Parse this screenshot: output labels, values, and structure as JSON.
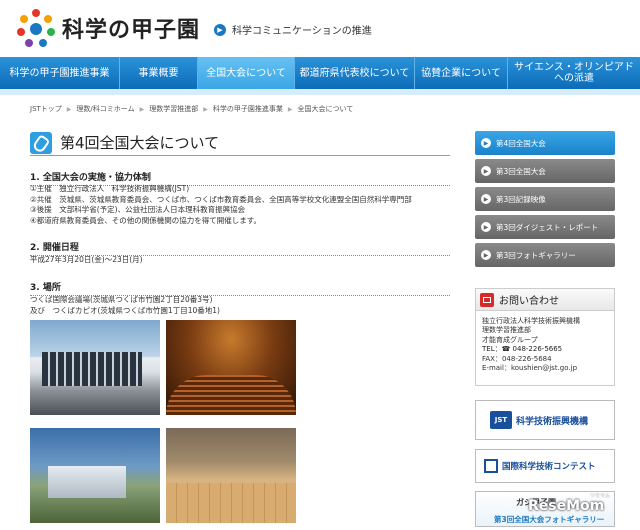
{
  "header": {
    "logo_text": "科学の甲子園",
    "tagline": "科学コミュニケーションの推進"
  },
  "nav": {
    "items": [
      {
        "label": "科学の甲子園推進事業",
        "active": false
      },
      {
        "label": "事業概要",
        "active": false
      },
      {
        "label": "全国大会について",
        "active": true
      },
      {
        "label": "都道府県代表校について",
        "active": false
      },
      {
        "label": "協賛企業について",
        "active": false
      },
      {
        "label": "サイエンス・オリンピアド\nへの派遣",
        "active": false
      }
    ]
  },
  "breadcrumb": [
    "JSTトップ",
    "理数/科コミホーム",
    "理数学習推進部",
    "科学の甲子園推進事業",
    "全国大会について"
  ],
  "page_title": "第4回全国大会について",
  "sections": {
    "s1_heading": "1. 全国大会の実施・協力体制",
    "s1_lines": [
      "①主催　独立行政法人　科学技術振興機構(JST)",
      "②共催　茨城県、茨城県教育委員会、つくば市、つくば市教育委員会、全国高等学校文化連盟全国自然科学専門部",
      "③後援　文部科学省(予定)、公益社団法人日本理科教育振興協会",
      "④都道府県教育委員会、その他の関係機関の協力を得て開催します。"
    ],
    "s2_heading": "2. 開催日程",
    "s2_lines": [
      "平成27年3月20日(金)～23日(月)"
    ],
    "s3_heading": "3. 場所",
    "s3_lines": [
      "つくば国際会議場(茨城県つくば市竹園2丁目20番3号)",
      "及び　つくばカピオ(茨城県つくば市竹園1丁目10番地1)"
    ]
  },
  "sidebar": {
    "menu": [
      {
        "label": "第4回全国大会",
        "active": true
      },
      {
        "label": "第3回全国大会",
        "active": false
      },
      {
        "label": "第3回記録映像",
        "active": false
      },
      {
        "label": "第3回ダイジェスト・レポート",
        "active": false
      },
      {
        "label": "第3回フォトギャラリー",
        "active": false
      }
    ],
    "contact": {
      "heading": "お問い合わせ",
      "lines": [
        "独立行政法人科学技術振興機構",
        "理数学習推進部",
        "才能育成グループ",
        "TEL：☎ 048-226-5665",
        "FAX：048-226-5684",
        "E-mail：koushien@jst.go.jp"
      ]
    },
    "banners": {
      "jst_label": "JST",
      "jst_text": "科学技術振興機構",
      "contest_text": "国際科学技術コンテスト",
      "gallery_top": "ガシ甲子園",
      "gallery_text": "第3回全国大会フォトギャラリー"
    }
  },
  "watermark": {
    "main": "ReseMom",
    "sub": "リセマム"
  }
}
